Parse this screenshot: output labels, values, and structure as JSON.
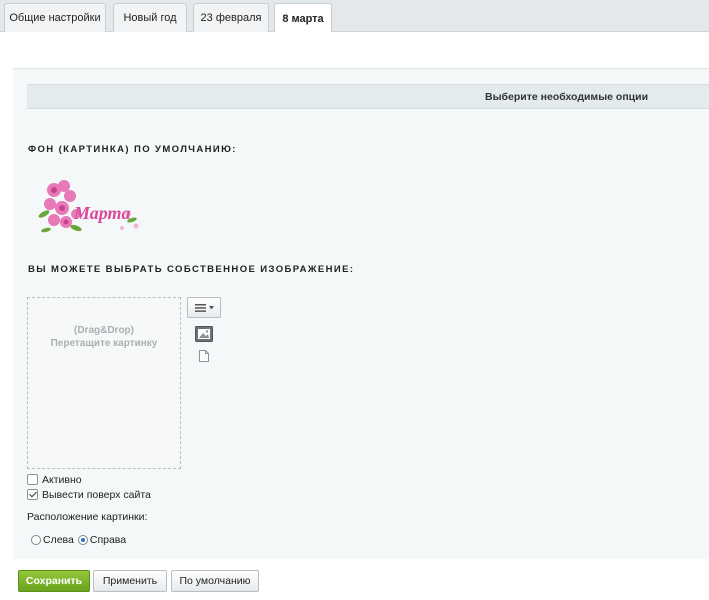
{
  "tabs": [
    {
      "label": "Общие настройки"
    },
    {
      "label": "Новый год"
    },
    {
      "label": "23 февраля"
    },
    {
      "label": "8 марта"
    }
  ],
  "options_header": "Выберите необходимые опции",
  "default_bg_label": "ФОН (КАРТИНКА) ПО УМОЛЧАНИЮ:",
  "preview_caption": "Марта",
  "custom_image_label": "ВЫ МОЖЕТЕ ВЫБРАТЬ СОБСТВЕННОЕ ИЗОБРАЖЕНИЕ:",
  "dropzone": {
    "line1": "(Drag&Drop)",
    "line2": "Перетащите картинку"
  },
  "checkboxes": {
    "active": {
      "label": "Активно",
      "checked": false
    },
    "overlay": {
      "label": "Вывести поверх сайта",
      "checked": true
    }
  },
  "position_label": "Расположение картинки:",
  "radios": {
    "left": {
      "label": "Слева",
      "checked": false
    },
    "right": {
      "label": "Справа",
      "checked": true
    }
  },
  "buttons": {
    "save": "Сохранить",
    "apply": "Применить",
    "default": "По умолчанию"
  },
  "colors": {
    "save_button": "#7cb22a",
    "panel_bg": "#f5f8f8",
    "preview_text": "#d9489b"
  }
}
